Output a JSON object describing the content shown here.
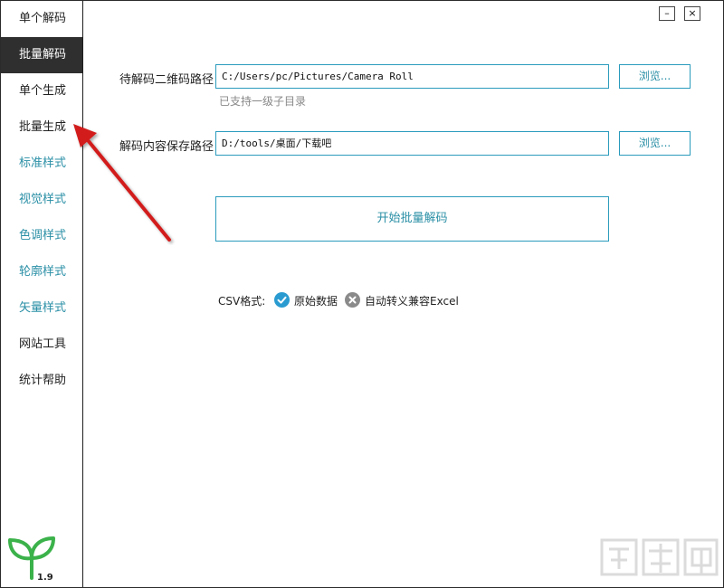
{
  "sidebar": {
    "items": [
      {
        "label": "单个解码"
      },
      {
        "label": "批量解码"
      },
      {
        "label": "单个生成"
      },
      {
        "label": "批量生成"
      },
      {
        "label": "标准样式"
      },
      {
        "label": "视觉样式"
      },
      {
        "label": "色调样式"
      },
      {
        "label": "轮廓样式"
      },
      {
        "label": "矢量样式"
      },
      {
        "label": "网站工具"
      },
      {
        "label": "统计帮助"
      }
    ],
    "active_index": 1,
    "version": "1.9",
    "logo_icon": "sprout-icon"
  },
  "window": {
    "minimize": "–",
    "close": "×"
  },
  "form": {
    "qr_path_label": "待解码二维码路径",
    "qr_path_value": "C:/Users/pc/Pictures/Camera Roll",
    "browse1_label": "浏览...",
    "hint": "已支持一级子目录",
    "save_path_label": "解码内容保存路径",
    "save_path_value": "D:/tools/桌面/下载吧",
    "browse2_label": "浏览...",
    "start_label": "开始批量解码"
  },
  "csv": {
    "label": "CSV格式:",
    "option1": "原始数据",
    "option2": "自动转义兼容Excel",
    "selected": "原始数据"
  },
  "colors": {
    "accent": "#2a9bbd",
    "active_nav": "#2f2f2f",
    "teal_text": "#2a8fa6",
    "arrow": "#d21f1f"
  }
}
